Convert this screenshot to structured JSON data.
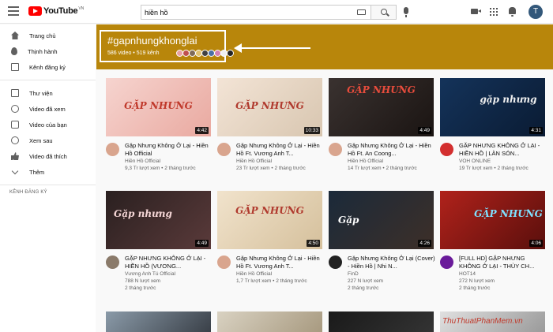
{
  "header": {
    "logo_text": "YouTube",
    "logo_region": "VN",
    "search_value": "hiền hồ",
    "avatar_letter": "T"
  },
  "sidebar": {
    "items": [
      {
        "label": "Trang chủ",
        "icon": "home-icon"
      },
      {
        "label": "Thịnh hành",
        "icon": "fire-icon"
      },
      {
        "label": "Kênh đăng ký",
        "icon": "subscriptions-icon"
      },
      {
        "label": "Thư viện",
        "icon": "library-icon"
      },
      {
        "label": "Video đã xem",
        "icon": "history-icon"
      },
      {
        "label": "Video của bạn",
        "icon": "your-videos-icon"
      },
      {
        "label": "Xem sau",
        "icon": "watch-later-icon"
      },
      {
        "label": "Video đã thích",
        "icon": "liked-icon"
      },
      {
        "label": "Thêm",
        "icon": "chevron-down-icon"
      }
    ],
    "section_header": "KÊNH ĐĂNG KÝ"
  },
  "banner": {
    "hashtag": "#gapnhungkhonglai",
    "stats": "586 video • 519 kênh",
    "color": "#b8860b"
  },
  "videos": [
    {
      "title": "Gặp Nhưng Không Ở Lại - Hiền Hồ Official",
      "title_display": "Gặp Nhưng Không Ở Lại - Hiền Hồ Official",
      "channel": "Hiền Hồ Official",
      "views": "9,3 Tr lượt xem • 2 tháng trước",
      "duration": "4:42",
      "art": "GẶP NHƯNG"
    },
    {
      "title": "Gặp Nhưng Không Ở Lại - Hiền Hồ Ft. Vương Anh T...",
      "channel": "Hiền Hồ Official",
      "views": "23 Tr lượt xem • 2 tháng trước",
      "duration": "10:33",
      "art": "GẶP NHƯNG"
    },
    {
      "title": "Gặp Nhưng Không Ở Lại - Hiền Hồ Ft. An Coong...",
      "channel": "Hiền Hồ Official",
      "views": "14 Tr lượt xem • 2 tháng trước",
      "duration": "4:49",
      "art": "GẶP NHƯNG"
    },
    {
      "title": "GẶP NHƯNG KHÔNG Ở LẠI - HIỀN HỒ | LÀN SÓN...",
      "channel": "VOH ONLINE",
      "views": "19 Tr lượt xem • 2 tháng trước",
      "duration": "4:31",
      "art": "gặp nhưng"
    },
    {
      "title": "GẶP NHƯNG KHÔNG Ở LẠI - HIỀN HỒ (VƯƠNG...",
      "channel": "Vương Anh Tú Official",
      "views": "788 N lượt xem",
      "views2": "2 tháng trước",
      "duration": "4:49",
      "art": "Gặp nhưng"
    },
    {
      "title": "Gặp Nhưng Không Ở Lại - Hiền Hồ Ft. Vương Anh T...",
      "channel": "Hiền Hồ Official",
      "views": "1,7 Tr lượt xem • 2 tháng trước",
      "duration": "4:50",
      "art": "GẶP NHƯNG"
    },
    {
      "title": "Gặp Nhưng Không Ở Lại (Cover) - Hiền Hồ | Nhi N...",
      "channel": "FinD",
      "views": "227 N lượt xem",
      "views2": "2 tháng trước",
      "duration": "4:26",
      "art": "Gặp"
    },
    {
      "title": "[FULL HD] GẶP NHƯNG KHÔNG Ở LẠI - THÙY CH...",
      "channel": "HOT14",
      "views": "272 N lượt xem",
      "views2": "2 tháng trước",
      "duration": "4:06",
      "art": "GẶP NHƯNG"
    }
  ],
  "watermark": "ThuThuatPhanMem.vn"
}
